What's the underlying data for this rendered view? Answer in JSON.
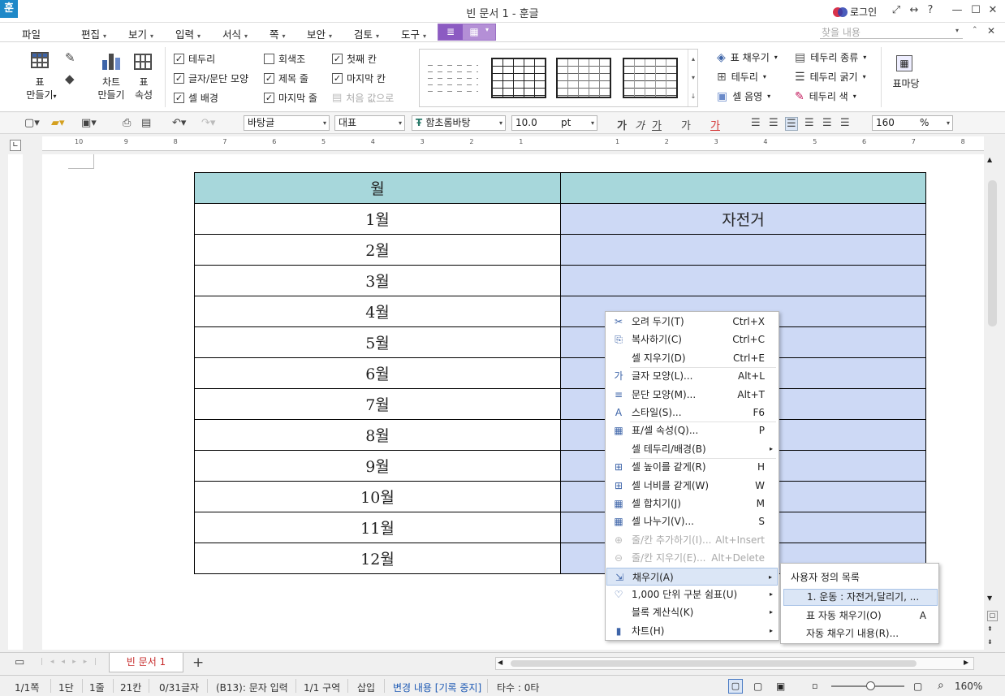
{
  "window": {
    "app_icon": "훈",
    "title": "빈 문서 1 - 훈글",
    "login": "로그인",
    "controls": [
      "⤢",
      "↔",
      "?",
      "—",
      "☐",
      "✕"
    ]
  },
  "menubar": {
    "items": [
      "파일",
      "편집",
      "보기",
      "입력",
      "서식",
      "쪽",
      "보안",
      "검토",
      "도구"
    ],
    "search_placeholder": "찾을 내용",
    "close": "✕"
  },
  "ribbon": {
    "table_make": [
      "표",
      "만들기"
    ],
    "chart_make": [
      "차트",
      "만들기"
    ],
    "table_props": [
      "표",
      "속성"
    ],
    "checks": [
      {
        "label": "테두리",
        "checked": true
      },
      {
        "label": "글자/문단 모양",
        "checked": true
      },
      {
        "label": "셀 배경",
        "checked": true
      },
      {
        "label": "회색조",
        "checked": false
      },
      {
        "label": "제목 줄",
        "checked": true
      },
      {
        "label": "마지막 줄",
        "checked": true
      },
      {
        "label": "첫째 칸",
        "checked": true
      },
      {
        "label": "마지막 칸",
        "checked": true
      },
      {
        "label": "처음 값으로",
        "checked": false
      }
    ],
    "fill": "표 채우기",
    "border": "테두리",
    "cell_shade": "셀 음영",
    "border_type": "테두리 종류",
    "border_width": "테두리 굵기",
    "border_color": "테두리 색",
    "table_margin": "표마당"
  },
  "toolbar": {
    "style": "바탕글",
    "rep": "대표",
    "font": "함초롬바탕",
    "size": "10.0",
    "unit": "pt",
    "zoom": "160",
    "zoom_unit": "%",
    "bold": "가",
    "italic": "가",
    "underline": "가",
    "strike": "가",
    "color_char": "가"
  },
  "ruler_numbers": [
    "10",
    "9",
    "8",
    "7",
    "6",
    "5",
    "4",
    "3",
    "2",
    "1",
    "1",
    "2",
    "3",
    "4",
    "5",
    "6",
    "7",
    "8"
  ],
  "table": {
    "header": [
      "월",
      ""
    ],
    "rows": [
      [
        "1월",
        "자전거"
      ],
      [
        "2월",
        ""
      ],
      [
        "3월",
        ""
      ],
      [
        "4월",
        ""
      ],
      [
        "5월",
        ""
      ],
      [
        "6월",
        ""
      ],
      [
        "7월",
        ""
      ],
      [
        "8월",
        ""
      ],
      [
        "9월",
        ""
      ],
      [
        "10월",
        ""
      ],
      [
        "11월",
        ""
      ],
      [
        "12월",
        ""
      ]
    ]
  },
  "context_menu": [
    {
      "icon": "✂",
      "label": "오려 두기(T)",
      "shortcut": "Ctrl+X"
    },
    {
      "icon": "⎘",
      "label": "복사하기(C)",
      "shortcut": "Ctrl+C"
    },
    {
      "icon": "",
      "label": "셀 지우기(D)",
      "shortcut": "Ctrl+E"
    },
    {
      "icon": "가",
      "label": "글자 모양(L)...",
      "shortcut": "Alt+L"
    },
    {
      "icon": "≡",
      "label": "문단 모양(M)...",
      "shortcut": "Alt+T"
    },
    {
      "icon": "A",
      "label": "스타일(S)...",
      "shortcut": "F6"
    },
    {
      "icon": "▦",
      "label": "표/셀 속성(Q)...",
      "shortcut": "P"
    },
    {
      "icon": "",
      "label": "셀 테두리/배경(B)",
      "shortcut": "▸"
    },
    {
      "icon": "⊞",
      "label": "셀 높이를 같게(R)",
      "shortcut": "H"
    },
    {
      "icon": "⊞",
      "label": "셀 너비를 같게(W)",
      "shortcut": "W"
    },
    {
      "icon": "▦",
      "label": "셀 합치기(J)",
      "shortcut": "M"
    },
    {
      "icon": "▦",
      "label": "셀 나누기(V)...",
      "shortcut": "S"
    },
    {
      "icon": "⊕",
      "label": "줄/칸 추가하기(I)...",
      "shortcut": "Alt+Insert"
    },
    {
      "icon": "⊖",
      "label": "줄/칸 지우기(E)...",
      "shortcut": "Alt+Delete"
    },
    {
      "icon": "⇲",
      "label": "채우기(A)",
      "shortcut": "▸"
    },
    {
      "icon": "♡",
      "label": "1,000 단위 구분 쉼표(U)",
      "shortcut": "▸"
    },
    {
      "icon": "",
      "label": "블록 계산식(K)",
      "shortcut": "▸"
    },
    {
      "icon": "▮",
      "label": "차트(H)",
      "shortcut": "▸"
    }
  ],
  "submenu": {
    "title": "사용자 정의 목록",
    "items": [
      {
        "label": "1. 운동 : 자전거,달리기, ...",
        "shortcut": ""
      },
      {
        "label": "표 자동 채우기(O)",
        "shortcut": "A"
      },
      {
        "label": "자동 채우기 내용(R)...",
        "shortcut": ""
      }
    ]
  },
  "tabs": {
    "doc": "빈 문서 1",
    "add": "+"
  },
  "status": {
    "page": "1/1쪽",
    "col": "1단",
    "line": "1줄",
    "cell": "21칸",
    "chars": "0/31글자",
    "mode": "(B13): 문자 입력",
    "section": "1/1 구역",
    "insert": "삽입",
    "track": "변경 내용 [기록 중지]",
    "typing": "타수 : 0타",
    "zoom": "160%"
  }
}
